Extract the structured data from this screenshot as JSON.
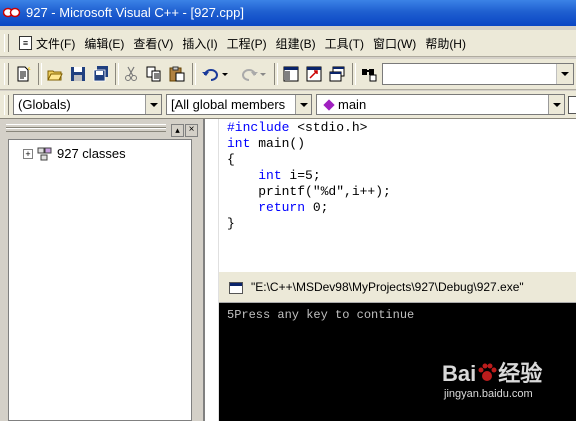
{
  "window": {
    "title": "927 - Microsoft Visual C++ - [927.cpp]"
  },
  "menu": [
    {
      "label": "文件(F)",
      "icon": "doc-icon"
    },
    {
      "label": "编辑(E)"
    },
    {
      "label": "查看(V)"
    },
    {
      "label": "插入(I)"
    },
    {
      "label": "工程(P)"
    },
    {
      "label": "组建(B)"
    },
    {
      "label": "工具(T)"
    },
    {
      "label": "窗口(W)"
    },
    {
      "label": "帮助(H)"
    }
  ],
  "toolbar": {
    "find_value": "",
    "icons": [
      "new-text-file-icon",
      "open-folder-icon",
      "save-icon",
      "save-all-icon",
      "cut-icon",
      "copy-icon",
      "paste-icon",
      "undo-icon",
      "redo-icon",
      "workspace-icon",
      "output-icon",
      "window-list-icon",
      "find-in-files-icon"
    ]
  },
  "wizard": {
    "scope": "(Globals)",
    "filter": "[All global members",
    "member": "main"
  },
  "workspace": {
    "tree_root": "927 classes"
  },
  "editor": {
    "lines": [
      {
        "kw": "#include",
        "rest": " <stdio.h>"
      },
      {
        "kw": "int",
        "rest": " main()"
      },
      {
        "kw": "",
        "rest": "{"
      },
      {
        "kw": "int",
        "rest": " i=5;",
        "indent": "    "
      },
      {
        "kw": "",
        "rest": "printf(\"%d\",i++);",
        "indent": "    "
      },
      {
        "kw": "return",
        "rest": " 0;",
        "indent": "    "
      },
      {
        "kw": "",
        "rest": "}"
      }
    ]
  },
  "console": {
    "title": "\"E:\\C++\\MSDev98\\MyProjects\\927\\Debug\\927.exe\"",
    "output": "5Press any key to continue"
  },
  "watermark": {
    "brand": "Bai",
    "brand2": "经验",
    "url": "jingyan.baidu.com"
  },
  "colors": {
    "keyword": "#0000ff",
    "titlebar": "#0a46c4",
    "console_bg": "#000000"
  }
}
